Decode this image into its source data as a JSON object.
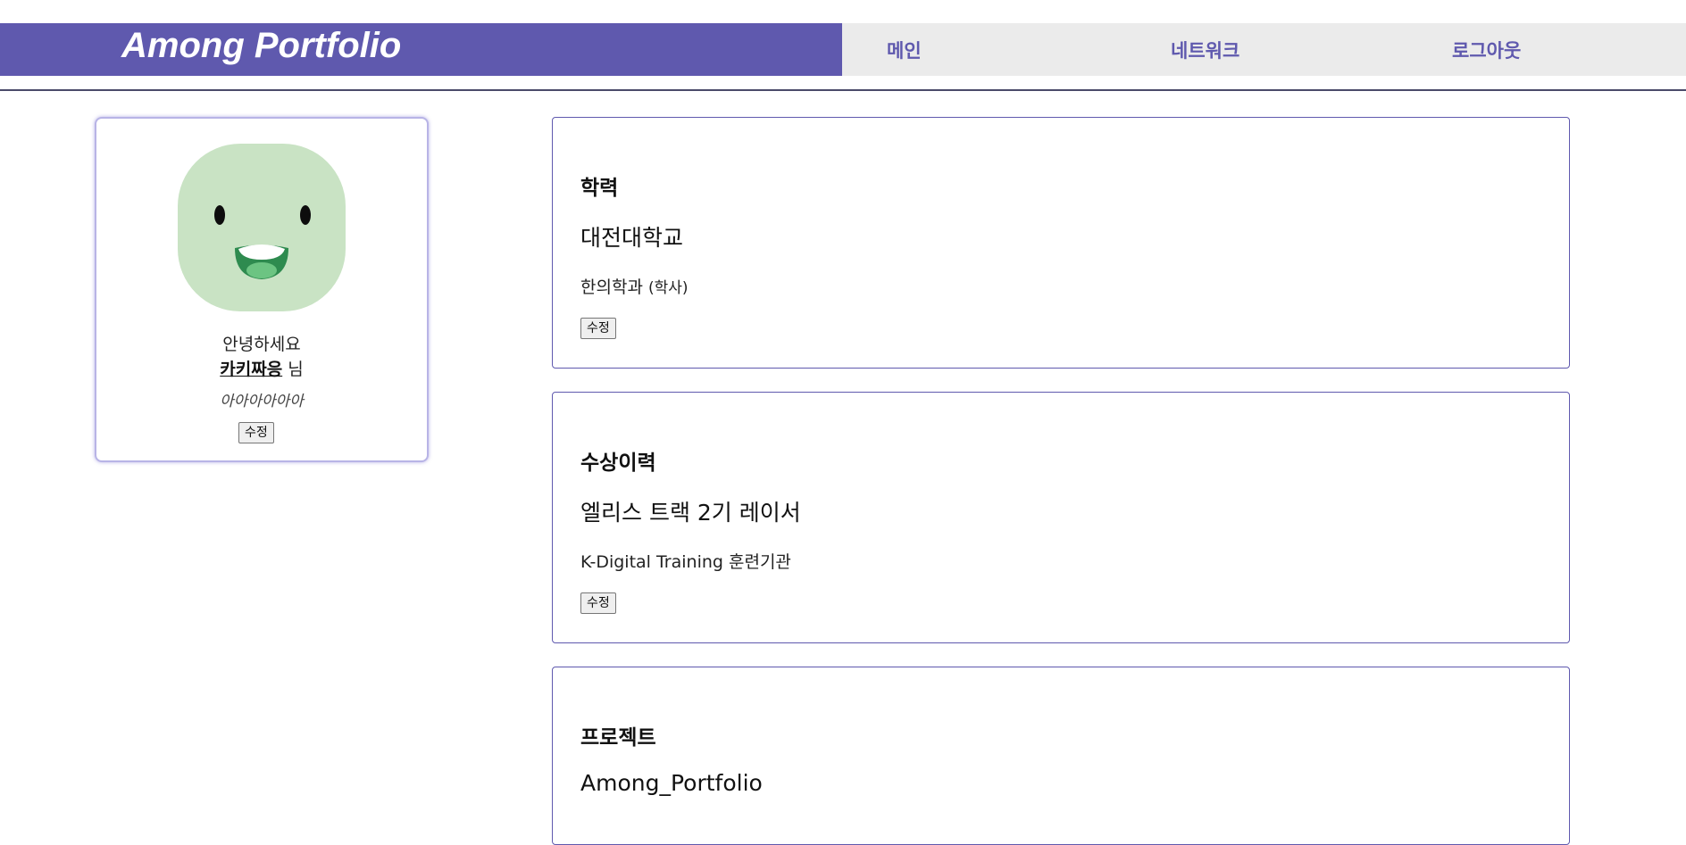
{
  "header": {
    "brand": "Among Portfolio",
    "brand_color": "#5f59ae",
    "nav": {
      "main": "메인",
      "network": "네트워크",
      "logout": "로그아웃"
    }
  },
  "profile": {
    "avatar_icon": "smiling-face-avatar",
    "greeting": "안녕하세요",
    "name": "카키짜응",
    "honorific": "님",
    "description": "아아아아아아",
    "edit_label": "수정"
  },
  "education": {
    "title": "학력",
    "school": "대전대학교",
    "major": "한의학과",
    "degree": "(학사)",
    "edit_label": "수정"
  },
  "awards": {
    "title": "수상이력",
    "award": "엘리스 트랙 2기 레이서",
    "description": "K-Digital Training 훈련기관",
    "edit_label": "수정"
  },
  "projects": {
    "title": "프로젝트",
    "project": "Among_Portfolio"
  }
}
